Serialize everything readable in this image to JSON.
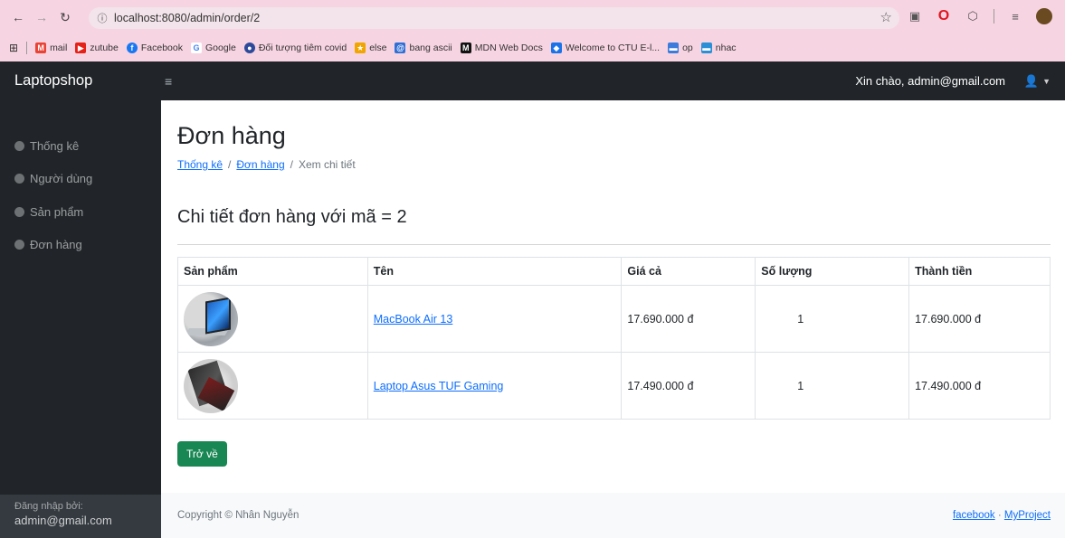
{
  "browser": {
    "url": "localhost:8080/admin/order/2",
    "bookmarks": [
      {
        "label": "mail",
        "color": "#ea4335",
        "glyph": "M"
      },
      {
        "label": "zutube",
        "color": "#e62117",
        "glyph": "▶"
      },
      {
        "label": "Facebook",
        "color": "#1877f2",
        "glyph": "f"
      },
      {
        "label": "Google",
        "color": "#4285f4",
        "glyph": "G"
      },
      {
        "label": "Đối tượng tiêm covid",
        "color": "#2d4a9a",
        "glyph": "●"
      },
      {
        "label": "else",
        "color": "#f0a500",
        "glyph": "★"
      },
      {
        "label": "bang ascii",
        "color": "#2f6fd6",
        "glyph": "@"
      },
      {
        "label": "MDN Web Docs",
        "color": "#111111",
        "glyph": "M"
      },
      {
        "label": "Welcome to CTU E-l...",
        "color": "#1a73e8",
        "glyph": "◆"
      },
      {
        "label": "op",
        "color": "#3b7bdc",
        "glyph": "▬"
      },
      {
        "label": "nhac",
        "color": "#2a8fd6",
        "glyph": "▬"
      }
    ]
  },
  "topbar": {
    "brand": "Laptopshop",
    "greeting": "Xin chào, admin@gmail.com"
  },
  "sidebar": {
    "items": [
      {
        "label": "Thống kê"
      },
      {
        "label": "Người dùng"
      },
      {
        "label": "Sản phẩm"
      },
      {
        "label": "Đơn hàng"
      }
    ],
    "footer_label": "Đăng nhập bởi:",
    "footer_user": "admin@gmail.com"
  },
  "main": {
    "title": "Đơn hàng",
    "breadcrumb": {
      "item1": "Thống kê",
      "sep": "/",
      "item2": "Đơn hàng",
      "current": "Xem chi tiết"
    },
    "section_title": "Chi tiết đơn hàng với mã = 2",
    "table": {
      "headers": [
        "Sản phẩm",
        "Tên",
        "Giá cả",
        "Số lượng",
        "Thành tiền"
      ],
      "rows": [
        {
          "name": "MacBook Air 13",
          "price": "17.690.000 đ",
          "qty": "1",
          "total": "17.690.000 đ"
        },
        {
          "name": "Laptop Asus TUF Gaming",
          "price": "17.490.000 đ",
          "qty": "1",
          "total": "17.490.000 đ"
        }
      ]
    },
    "back_button": "Trở về"
  },
  "footer": {
    "copyright": "Copyright © Nhân Nguyễn",
    "link1": "facebook",
    "sep": "·",
    "link2": "MyProject"
  }
}
